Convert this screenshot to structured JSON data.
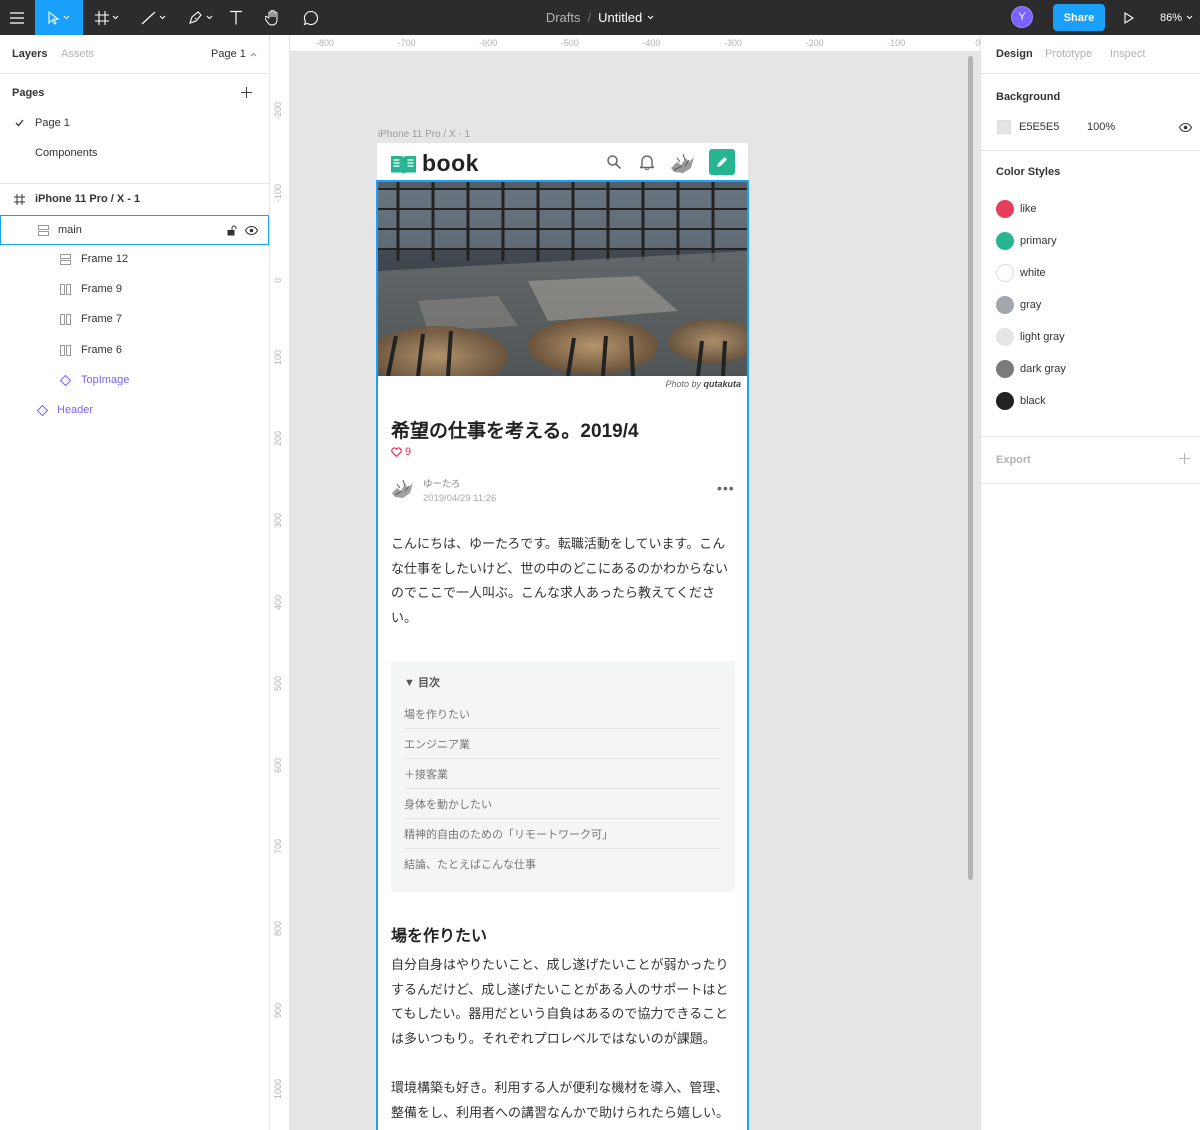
{
  "toolbar": {
    "breadcrumb_drafts": "Drafts",
    "breadcrumb_sep": "/",
    "file_name": "Untitled",
    "avatar_initial": "Y",
    "share_label": "Share",
    "zoom": "86%"
  },
  "left_panel": {
    "tabs": [
      "Layers",
      "Assets"
    ],
    "page_selector": "Page 1",
    "pages_heading": "Pages",
    "pages": [
      "Page 1",
      "Components"
    ],
    "layers": [
      {
        "name": "iPhone 11 Pro / X - 1"
      },
      {
        "name": "main"
      },
      {
        "name": "Frame 12"
      },
      {
        "name": "Frame 9"
      },
      {
        "name": "Frame 7"
      },
      {
        "name": "Frame 6"
      },
      {
        "name": "TopImage"
      },
      {
        "name": "Header"
      }
    ]
  },
  "rulers": {
    "top": [
      "-800",
      "-700",
      "-600",
      "-500",
      "-400",
      "-300",
      "-200",
      "-100",
      "0"
    ],
    "left": [
      "-200",
      "-100",
      "0",
      "100",
      "200",
      "300",
      "400",
      "500",
      "600",
      "700",
      "800",
      "900",
      "1000"
    ]
  },
  "right_panel": {
    "tabs": [
      "Design",
      "Prototype",
      "Inspect"
    ],
    "background_heading": "Background",
    "background_hex": "E5E5E5",
    "background_opacity": "100%",
    "color_styles_heading": "Color Styles",
    "color_styles": [
      {
        "name": "like",
        "color": "#e83e5e"
      },
      {
        "name": "primary",
        "color": "#28b592"
      },
      {
        "name": "white",
        "color": "#ffffff"
      },
      {
        "name": "gray",
        "color": "#a3a6aa"
      },
      {
        "name": "light gray",
        "color": "#e5e5e5"
      },
      {
        "name": "dark gray",
        "color": "#7a7b7d"
      },
      {
        "name": "black",
        "color": "#222222"
      }
    ],
    "export_heading": "Export"
  },
  "frame": {
    "label": "iPhone 11 Pro / X - 1",
    "logo_text": "book",
    "photo_credit_prefix": "Photo by",
    "photo_credit_author": "qutakuta",
    "article_title": "希望の仕事を考える。2019/4",
    "like_count": "9",
    "author_name": "ゆーたろ",
    "author_date": "2019/04/29 11:26",
    "intro": "こんにちは、ゆーたろです。転職活動をしています。こんな仕事をしたいけど、世の中のどこにあるのかわからないのでここで一人叫ぶ。こんな求人あったら教えてください。",
    "toc_heading": "▼ 目次",
    "toc_items": [
      "場を作りたい",
      "エンジニア業",
      "＋接客業",
      "身体を動かしたい",
      "精神的自由のための「リモートワーク可」",
      "結論、たとえばこんな仕事"
    ],
    "section_title": "場を作りたい",
    "para1": "自分自身はやりたいこと、成し遂げたいことが弱かったりするんだけど、成し遂げたいことがある人のサポートはとてもしたい。器用だという自負はあるので協力できることは多いつもり。それぞれプロレベルではないのが課題。",
    "para2": "環境構築も好き。利用する人が便利な機材を導入、管理、整備をし、利用者への講習なんかで助けられたら嬉しい。"
  }
}
